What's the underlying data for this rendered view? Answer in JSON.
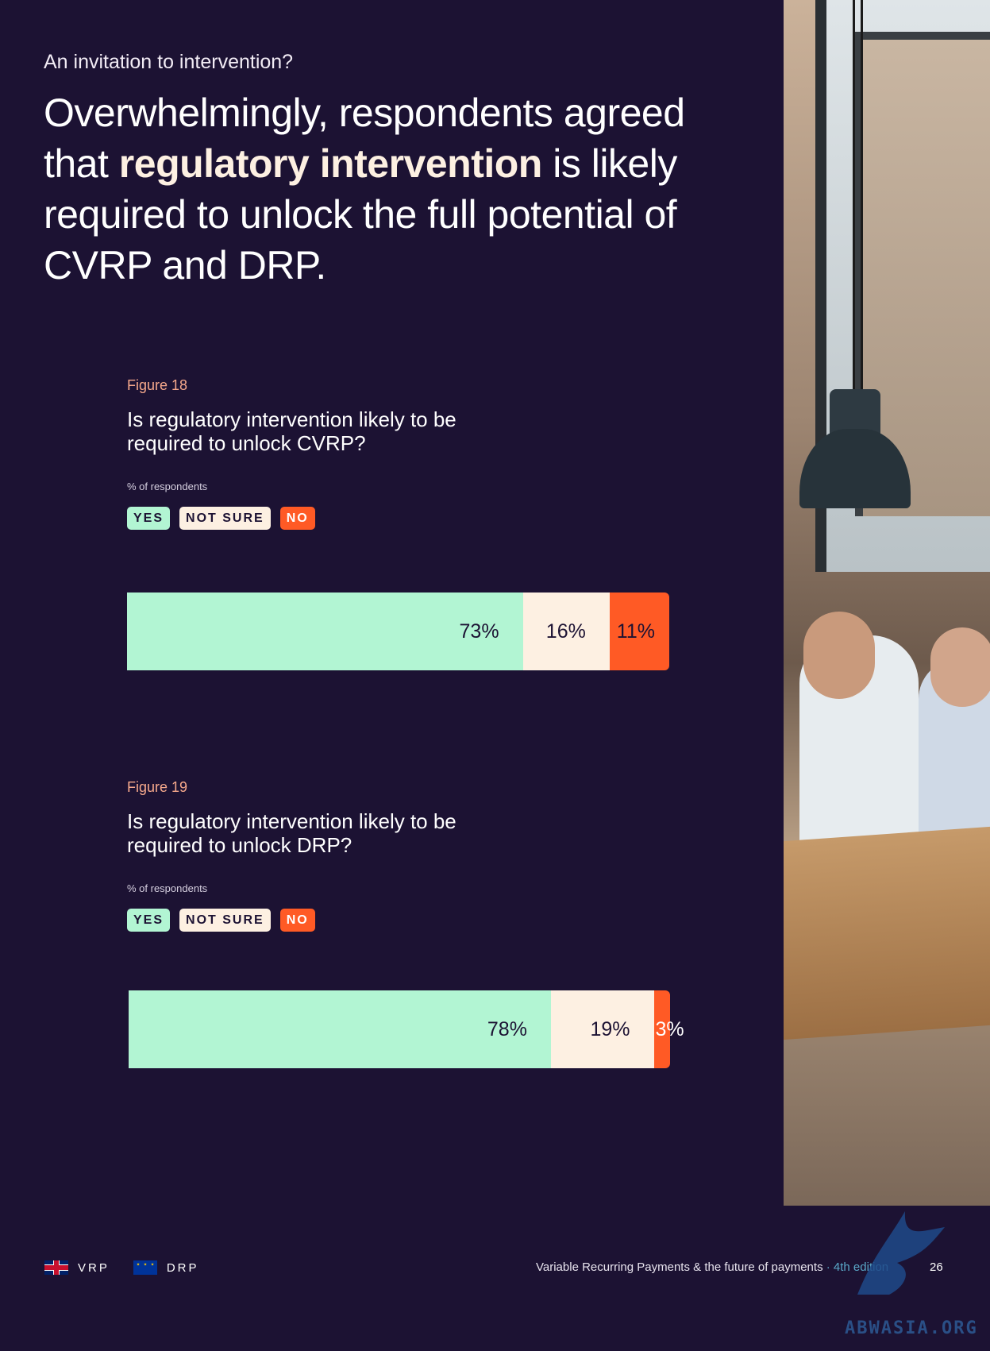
{
  "eyebrow": "An invitation to intervention?",
  "headline": {
    "part1": "Overwhelmingly, respondents agreed that ",
    "strong": "regulatory intervention",
    "part2": " is likely required to unlock the full potential of CVRP and DRP."
  },
  "legend": {
    "yes": "YES",
    "not_sure": "NOT SURE",
    "no": "NO"
  },
  "colors": {
    "background": "#1c1233",
    "yes": "#b2f5d3",
    "not_sure": "#fdf0e2",
    "no": "#ff5a25",
    "accent": "#f6a98c"
  },
  "chart_data": [
    {
      "type": "bar",
      "orientation": "horizontal-stacked-100",
      "figure_label": "Figure 18",
      "title": "Is regulatory intervention likely to be required to unlock CVRP?",
      "unit_label": "% of respondents",
      "categories": [
        "YES",
        "NOT SURE",
        "NO"
      ],
      "values": [
        73,
        16,
        11
      ],
      "value_labels": [
        "73%",
        "16%",
        "11%"
      ]
    },
    {
      "type": "bar",
      "orientation": "horizontal-stacked-100",
      "figure_label": "Figure 19",
      "title": "Is regulatory intervention likely to be required to unlock DRP?",
      "unit_label": "% of respondents",
      "categories": [
        "YES",
        "NOT SURE",
        "NO"
      ],
      "values": [
        78,
        19,
        3
      ],
      "value_labels": [
        "78%",
        "19%",
        "3%"
      ]
    }
  ],
  "footer": {
    "vrp_label": "VRP",
    "drp_label": "DRP",
    "doc_title": "Variable Recurring Payments & the future of payments",
    "edition": " · 4th edition",
    "page_number": "26"
  },
  "watermark": "ABWASIA.ORG",
  "photo_icon": "office-meeting-photo"
}
